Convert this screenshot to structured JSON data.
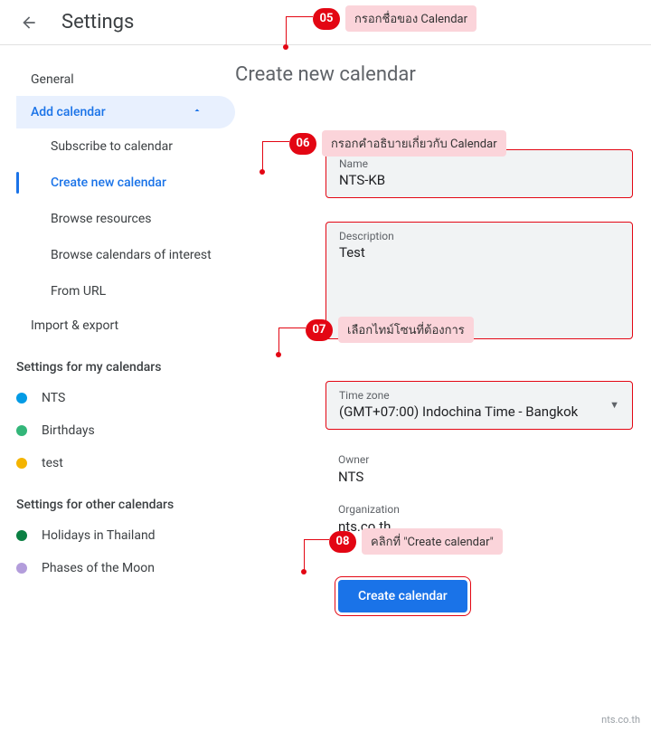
{
  "header": {
    "title": "Settings"
  },
  "sidebar": {
    "general": "General",
    "add_calendar": "Add calendar",
    "subs": {
      "subscribe": "Subscribe to calendar",
      "create": "Create new calendar",
      "browse_res": "Browse resources",
      "browse_int": "Browse calendars of interest",
      "from_url": "From URL"
    },
    "import_export": "Import & export",
    "my_cal_title": "Settings for my calendars",
    "my_cals": [
      {
        "name": "NTS",
        "color": "#039be5"
      },
      {
        "name": "Birthdays",
        "color": "#33b679"
      },
      {
        "name": "test",
        "color": "#f4b400"
      }
    ],
    "other_cal_title": "Settings for other calendars",
    "other_cals": [
      {
        "name": "Holidays in Thailand",
        "color": "#0b8043"
      },
      {
        "name": "Phases of the Moon",
        "color": "#b39ddb"
      }
    ]
  },
  "content": {
    "title": "Create new calendar",
    "name_label": "Name",
    "name_value": "NTS-KB",
    "desc_label": "Description",
    "desc_value": "Test",
    "tz_label": "Time zone",
    "tz_value": "(GMT+07:00) Indochina Time - Bangkok",
    "owner_label": "Owner",
    "owner_value": "NTS",
    "org_label": "Organization",
    "org_value": "nts.co.th",
    "create_btn": "Create calendar"
  },
  "annotations": {
    "a05": {
      "num": "05",
      "text": "กรอกชื่อของ Calendar"
    },
    "a06": {
      "num": "06",
      "text": "กรอกคำอธิบายเกี่ยวกับ Calendar"
    },
    "a07": {
      "num": "07",
      "text": "เลือกไทม์โซนที่ต้องการ"
    },
    "a08": {
      "num": "08",
      "text": "คลิกที่ \"Create calendar\""
    }
  },
  "footer": "nts.co.th"
}
